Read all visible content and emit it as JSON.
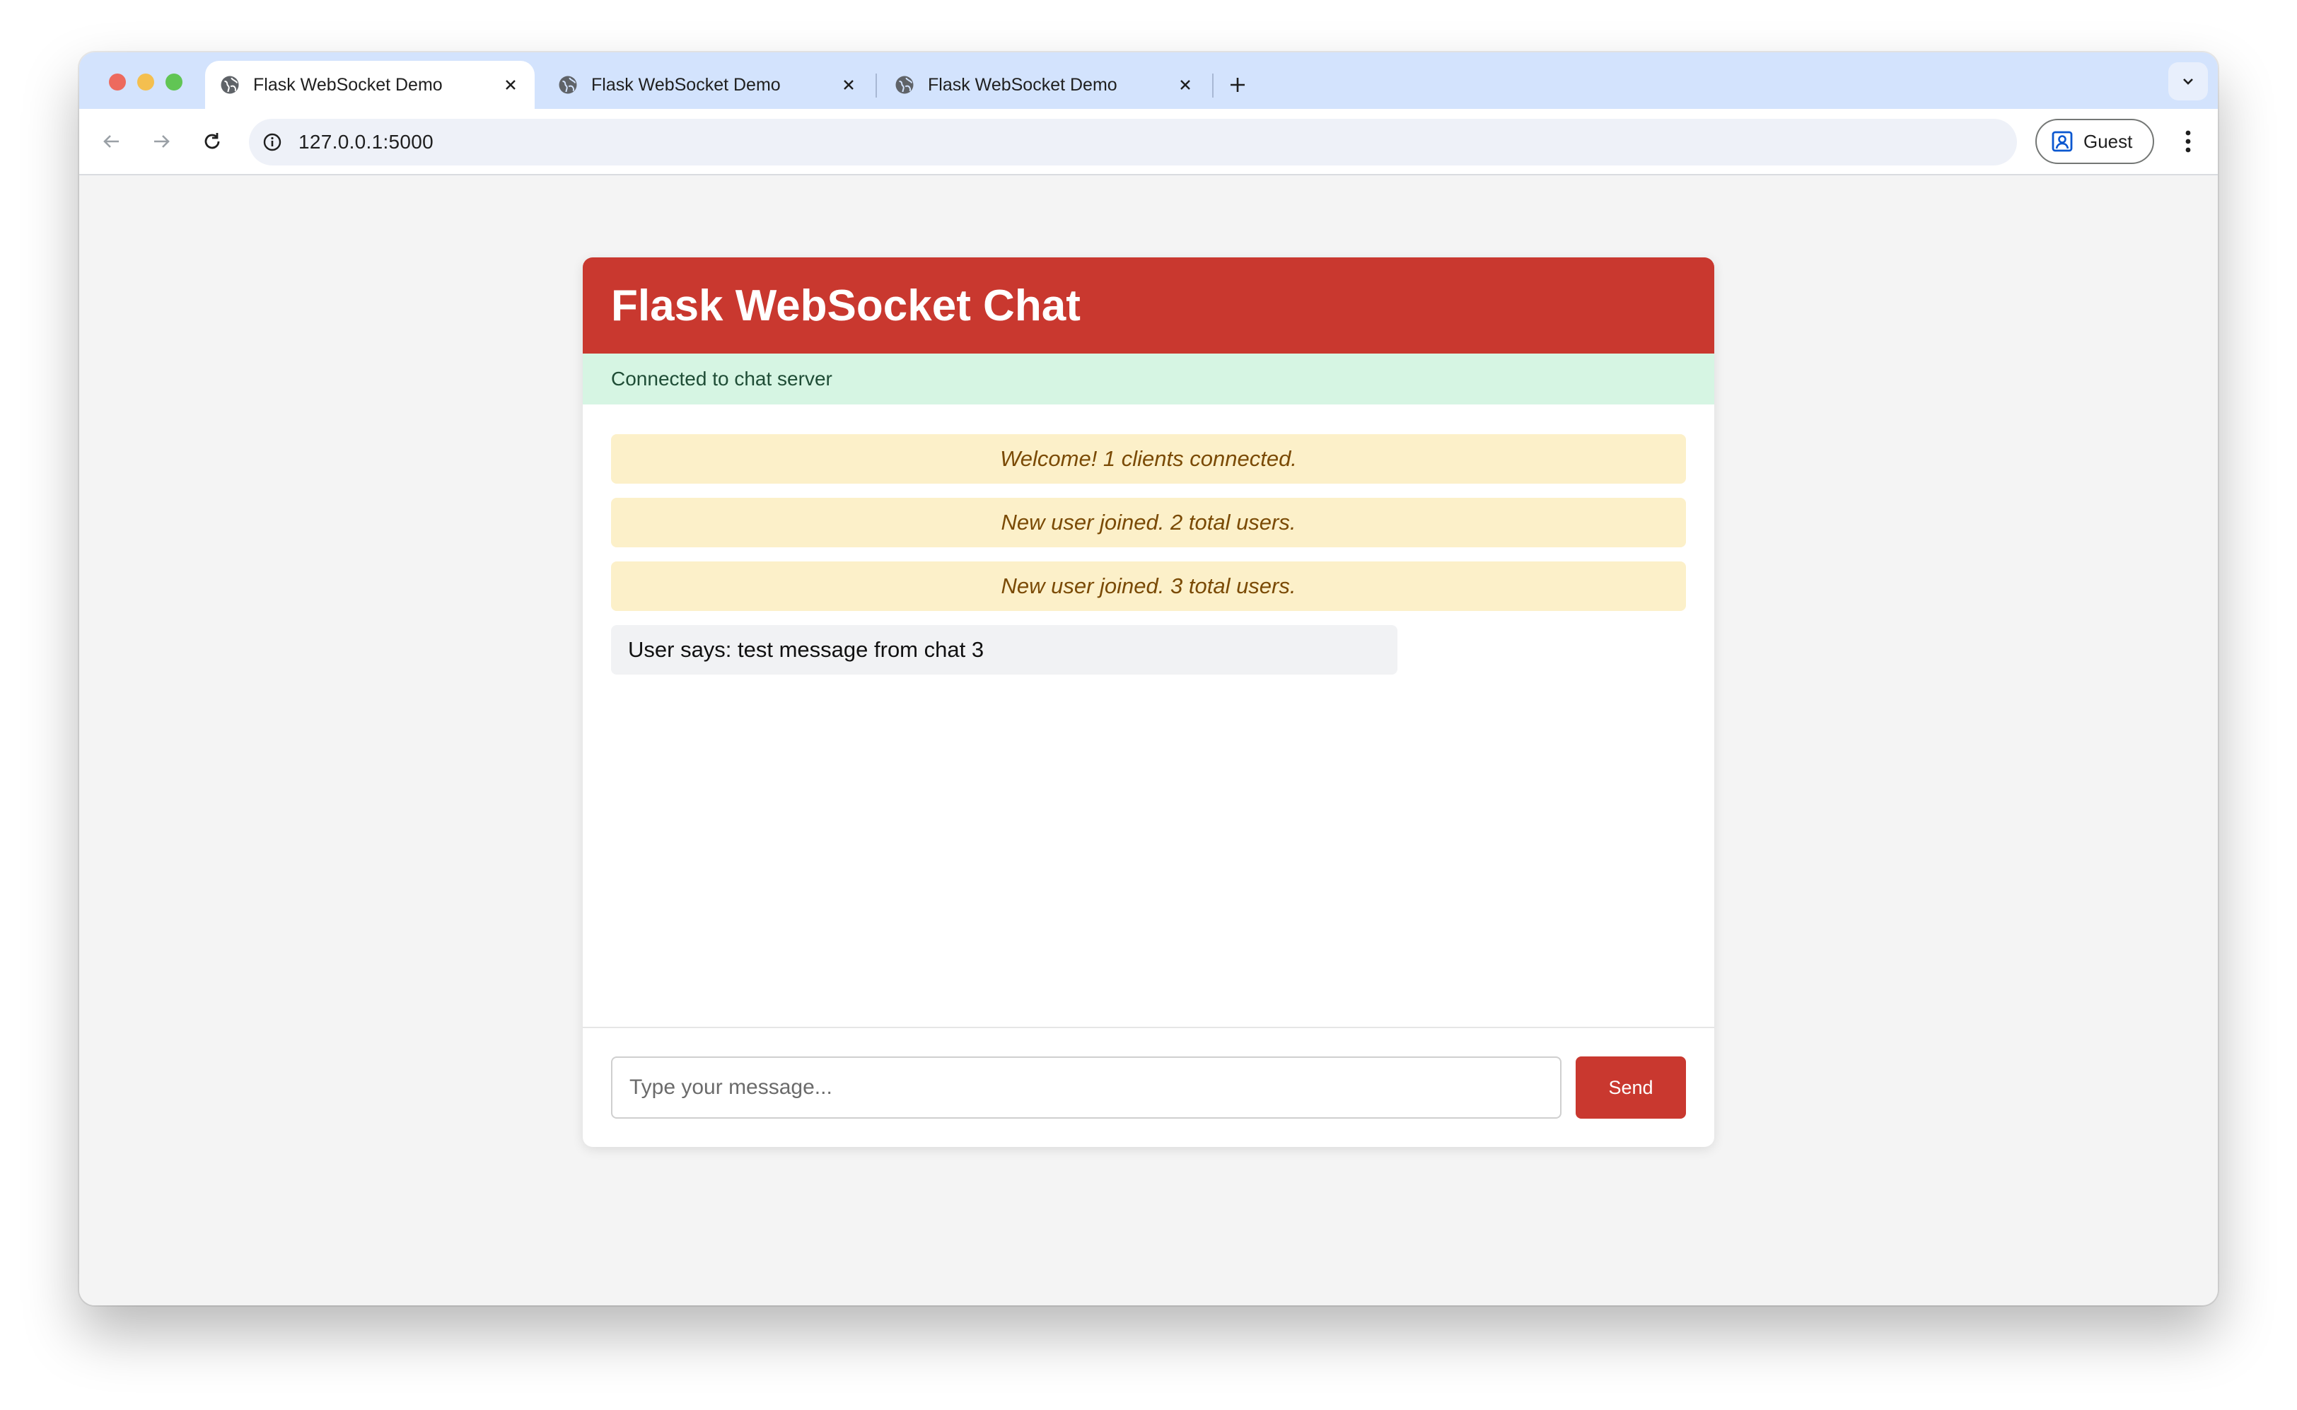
{
  "browser": {
    "tabs": [
      {
        "title": "Flask WebSocket Demo",
        "active": true
      },
      {
        "title": "Flask WebSocket Demo",
        "active": false
      },
      {
        "title": "Flask WebSocket Demo",
        "active": false
      }
    ],
    "url": "127.0.0.1:5000",
    "profile_label": "Guest"
  },
  "chat": {
    "title": "Flask WebSocket Chat",
    "status": "Connected to chat server",
    "system_messages": [
      "Welcome! 1 clients connected.",
      "New user joined. 2 total users.",
      "New user joined. 3 total users."
    ],
    "user_messages": [
      "User says: test message from chat 3"
    ],
    "input_placeholder": "Type your message...",
    "send_label": "Send"
  },
  "colors": {
    "accent": "#c9382f",
    "status_bg": "#d6f5e3",
    "system_msg_bg": "#fcf0c9",
    "tabstrip_bg": "#d3e3fd"
  }
}
